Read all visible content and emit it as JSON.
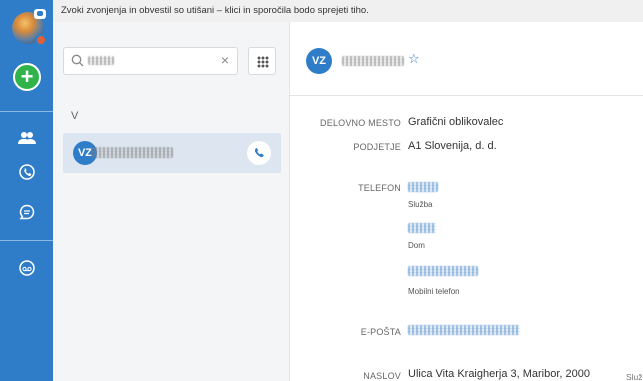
{
  "notice": "Zvoki zvonjenja in obvestil so utišani – klici in sporočila bodo sprejeti tiho.",
  "rail": {
    "add_label": "+",
    "icons": [
      "contacts-icon",
      "phone-icon",
      "chat-icon",
      "voicemail-icon"
    ]
  },
  "search": {
    "clear_label": "×"
  },
  "list": {
    "section_letter": "V",
    "contact": {
      "initials": "VZ"
    }
  },
  "detail": {
    "initials": "VZ",
    "star": "☆",
    "job_label": "DELOVNO MESTO",
    "job_value": "Grafični oblikovalec",
    "dept_label": "PODJETJE",
    "dept_value": "A1 Slovenija, d. d.",
    "phone_label": "TELEFON",
    "phone_types": [
      "Služba",
      "Dom",
      "Mobilni telefon"
    ],
    "email_label": "E-POŠTA",
    "address_label": "NASLOV",
    "address_value": "Ulica Vita Kraigherja 3, Maribor, 2000",
    "address_type": "Služ"
  },
  "colors": {
    "accent": "#2f7dc9",
    "add": "#2fb34a",
    "busy": "#e0603a"
  }
}
